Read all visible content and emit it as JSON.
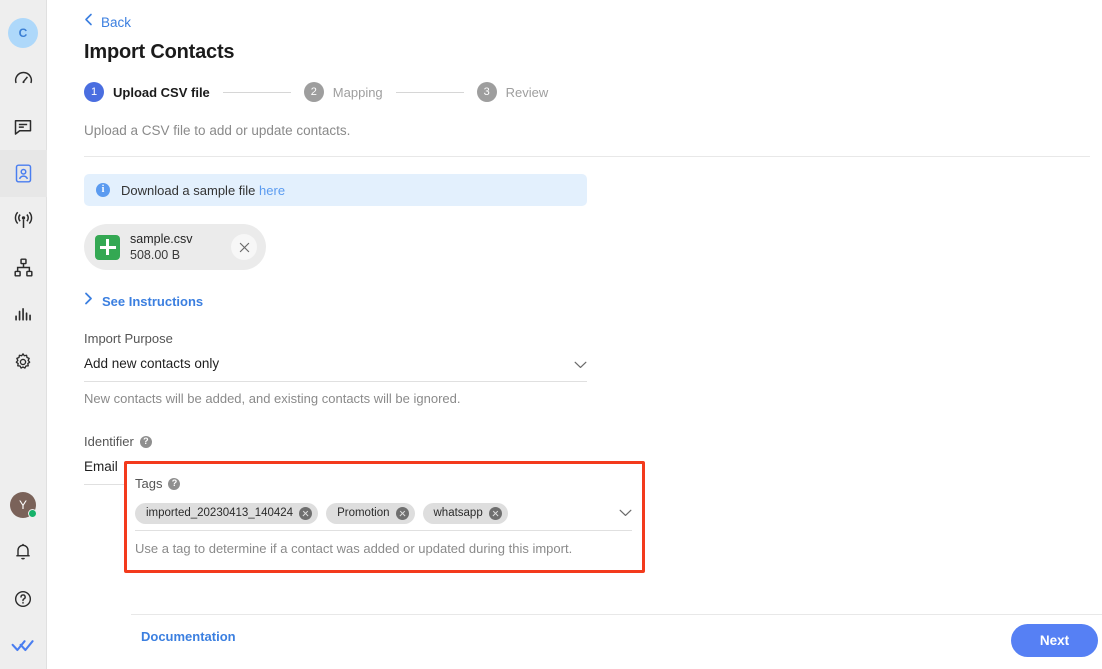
{
  "sidebar": {
    "workspace_avatar": {
      "initial": "C",
      "bg": "#aed8fa",
      "fg": "#3b7fd4"
    },
    "items": [
      {
        "name": "dashboard",
        "icon": "speedometer-icon",
        "active": false
      },
      {
        "name": "messages",
        "icon": "chat-bubble-icon",
        "active": false
      },
      {
        "name": "contacts",
        "icon": "contact-card-icon",
        "active": true
      },
      {
        "name": "broadcast",
        "icon": "broadcast-antenna-icon",
        "active": false
      },
      {
        "name": "workflows",
        "icon": "sitemap-icon",
        "active": false
      },
      {
        "name": "analytics",
        "icon": "bar-chart-icon",
        "active": false
      },
      {
        "name": "settings",
        "icon": "gear-icon",
        "active": false
      }
    ],
    "user_avatar": {
      "initial": "Y",
      "bg": "#7a6259",
      "status": "online",
      "status_color": "#17b26a"
    },
    "bottom_items": [
      {
        "name": "notifications",
        "icon": "bell-icon"
      },
      {
        "name": "help",
        "icon": "question-circle-icon"
      },
      {
        "name": "app-logo",
        "icon": "double-check-icon"
      }
    ],
    "active_color": "#4a7ef0"
  },
  "header": {
    "back_label": "Back",
    "title": "Import Contacts"
  },
  "stepper": {
    "steps": [
      {
        "number": "1",
        "label": "Upload CSV file",
        "state": "current"
      },
      {
        "number": "2",
        "label": "Mapping",
        "state": "idle"
      },
      {
        "number": "3",
        "label": "Review",
        "state": "idle"
      }
    ],
    "current_color": "#4a6ee0",
    "idle_color": "#9e9e9e"
  },
  "intro": {
    "text": "Upload a CSV file to add or update contacts."
  },
  "info_banner": {
    "icon": "info-circle-icon",
    "text": "Download a sample file",
    "link_label": "here",
    "bg": "#e3f0fd",
    "link_color": "#5b9bf0"
  },
  "uploaded_file": {
    "icon": "spreadsheet-icon",
    "name": "sample.csv",
    "size": "508.00 B",
    "remove_label": "×"
  },
  "instructions": {
    "label": "See Instructions",
    "expanded": false
  },
  "import_purpose": {
    "label": "Import Purpose",
    "value": "Add new contacts only",
    "hint": "New contacts will be added, and existing contacts will be ignored."
  },
  "identifier": {
    "label": "Identifier",
    "help_icon": "question-mark-icon",
    "value": "Email"
  },
  "tags": {
    "label": "Tags",
    "help_icon": "question-mark-icon",
    "chips": [
      {
        "label": "imported_20230413_140424"
      },
      {
        "label": "Promotion"
      },
      {
        "label": "whatsapp"
      }
    ],
    "hint": "Use a tag to determine if a contact was added or updated during this import.",
    "highlight_color": "#f33a1c"
  },
  "footer": {
    "documentation_label": "Documentation",
    "next_label": "Next",
    "next_color": "#5680f4"
  }
}
